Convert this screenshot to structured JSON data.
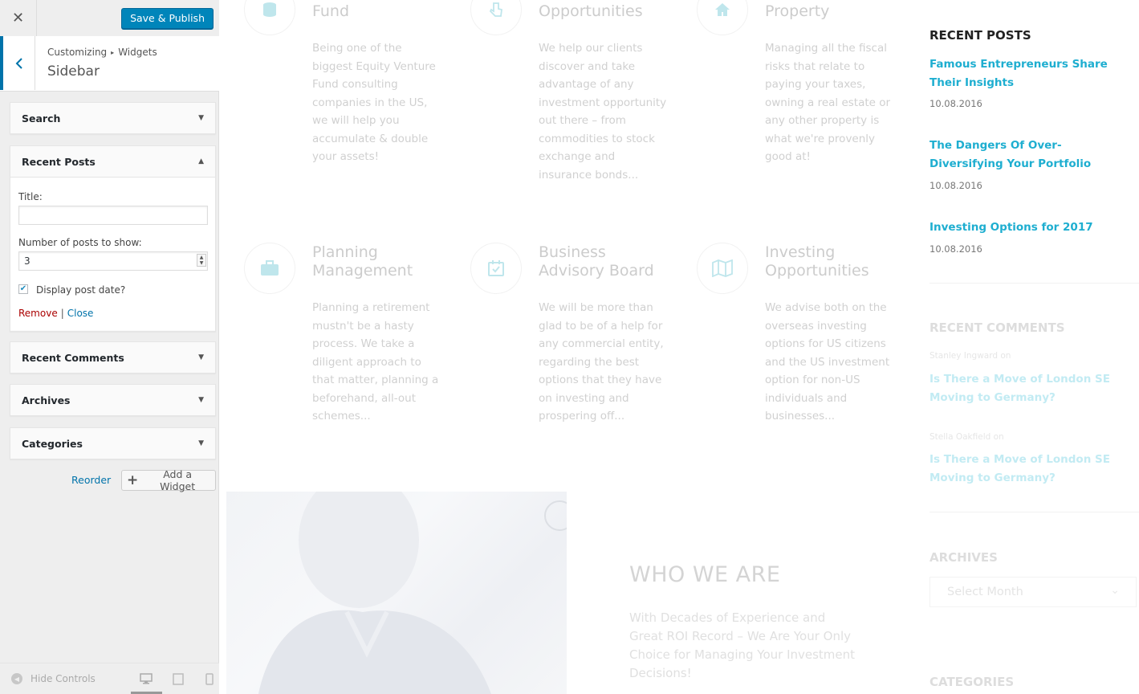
{
  "customizer": {
    "close_icon": "close-icon",
    "save_label": "Save & Publish",
    "breadcrumb_parent": "Customizing",
    "breadcrumb_current": "Widgets",
    "panel_title": "Sidebar",
    "widgets": {
      "search": "Search",
      "recent_posts": "Recent Posts",
      "recent_comments": "Recent Comments",
      "archives": "Archives",
      "categories": "Categories"
    },
    "recent_posts_form": {
      "title_label": "Title:",
      "title_value": "",
      "number_label": "Number of posts to show:",
      "number_value": "3",
      "display_date_label": "Display post date?",
      "display_date_checked": true,
      "remove_label": "Remove",
      "separator": "|",
      "close_label": "Close"
    },
    "reorder_label": "Reorder",
    "add_widget_label": "Add a Widget",
    "hide_controls_label": "Hide Controls",
    "accent_color": "#0085ba"
  },
  "preview": {
    "services_top": [
      {
        "title": "Fund",
        "text": "Being one of the biggest Equity Venture Fund consulting companies in the US, we will help you accumulate & double your assets!",
        "icon": "database-icon"
      },
      {
        "title": "Opportunities",
        "text": "We help our clients discover and take advantage of any investment opportunity out there – from commodities to stock exchange and insurance bonds...",
        "icon": "hand-pointer-icon"
      },
      {
        "title": "Property",
        "text": "Managing all the fiscal risks that relate to paying your taxes, owning a real estate or any other property is what we're provenly good at!",
        "icon": "home-icon"
      }
    ],
    "services_bottom": [
      {
        "title": "Planning Management",
        "text": "Planning a retirement mustn't be a hasty process. We take a diligent approach to that matter, planning a beforehand, all-out schemes...",
        "icon": "briefcase-icon"
      },
      {
        "title": "Business Advisory Board",
        "text": "We will be more than glad to be of a help for any commercial entity, regarding the best options that they have on investing and prospering off...",
        "icon": "calendar-check-icon"
      },
      {
        "title": "Investing Opportunities",
        "text": "We advise both on the overseas investing options for US citizens and the US investment option for non-US individuals and businesses...",
        "icon": "map-icon"
      }
    ],
    "who_title": "WHO WE ARE",
    "who_text": "With Decades of Experience and Great ROI Record – We Are Your Only Choice for Managing Your Investment Decisions!",
    "sidebar": {
      "recent_posts_heading": "RECENT POSTS",
      "posts": [
        {
          "title": "Famous Entrepreneurs Share Their Insights",
          "date": "10.08.2016"
        },
        {
          "title": "The Dangers Of Over-Diversifying Your Portfolio",
          "date": "10.08.2016"
        },
        {
          "title": "Investing Options for 2017",
          "date": "10.08.2016"
        }
      ],
      "recent_comments_heading": "RECENT COMMENTS",
      "comments": [
        {
          "author": "Stanley Ingward on",
          "title": "Is There a Move of London SE Moving to Germany?"
        },
        {
          "author": "Stella Oakfield on",
          "title": "Is There a Move of London SE Moving to Germany?"
        }
      ],
      "archives_heading": "ARCHIVES",
      "archives_select": "Select Month",
      "categories_heading": "CATEGORIES",
      "link_color": "#1eaed0"
    }
  }
}
